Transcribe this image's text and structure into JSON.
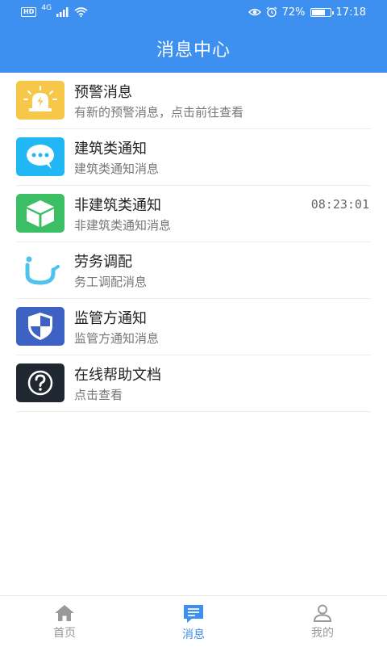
{
  "statusbar": {
    "hd": "HD",
    "network": "4G",
    "battery_percent": "72%",
    "battery_level": 0.72,
    "time": "17:18"
  },
  "header": {
    "title": "消息中心"
  },
  "messages": [
    {
      "title": "预警消息",
      "subtitle": "有新的预警消息，点击前往查看",
      "time": "",
      "icon": "alarm-light-icon",
      "icon_bg": "#f7c74a"
    },
    {
      "title": "建筑类通知",
      "subtitle": "建筑类通知消息",
      "time": "",
      "icon": "chat-bubble-icon",
      "icon_bg": "#21b7f5"
    },
    {
      "title": "非建筑类通知",
      "subtitle": "非建筑类通知消息",
      "time": "08:23:01",
      "icon": "cube-icon",
      "icon_bg": "#3cbf64"
    },
    {
      "title": "劳务调配",
      "subtitle": "务工调配消息",
      "time": "",
      "icon": "labor-logo-icon",
      "icon_bg": "#ffffff"
    },
    {
      "title": "监管方通知",
      "subtitle": "监管方通知消息",
      "time": "",
      "icon": "shield-icon",
      "icon_bg": "#3e62c4"
    },
    {
      "title": "在线帮助文档",
      "subtitle": "点击查看",
      "time": "",
      "icon": "question-icon",
      "icon_bg": "#1f2730"
    }
  ],
  "tabs": [
    {
      "label": "首页",
      "icon": "home-icon",
      "active": false
    },
    {
      "label": "消息",
      "icon": "message-icon",
      "active": true
    },
    {
      "label": "我的",
      "icon": "person-icon",
      "active": false
    }
  ],
  "colors": {
    "primary": "#3d8ff0",
    "inactive": "#999999"
  }
}
